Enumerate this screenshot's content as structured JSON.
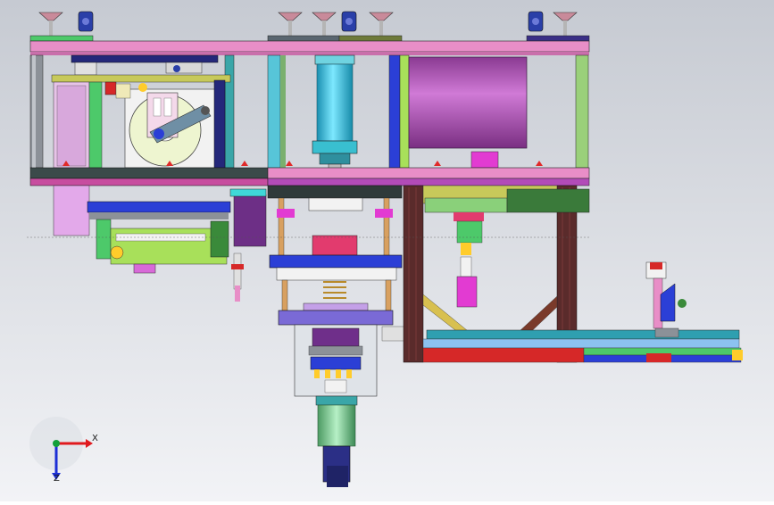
{
  "viewport": {
    "background_top": "#c6cad2",
    "background_bottom": "#f2f3f6"
  },
  "triad": {
    "x_label": "X",
    "z_label": "Z",
    "x_axis_color": "#e0191e",
    "z_axis_color": "#1c2fd6",
    "origin_color": "#12a03a"
  },
  "colors": {
    "frame_pink": "#e88ec7",
    "frame_dark": "#3b4a4a",
    "cylinder_cyan": "#35cde8",
    "drum_magenta": "#b24bb8",
    "navy": "#24287a",
    "blue": "#2b3fd6",
    "green": "#3fbf57",
    "lime": "#a8e05a",
    "teal": "#3aa6a8",
    "purple": "#6d2f86",
    "red": "#d62828",
    "brown": "#5a2b2b",
    "gray": "#8c9198"
  }
}
